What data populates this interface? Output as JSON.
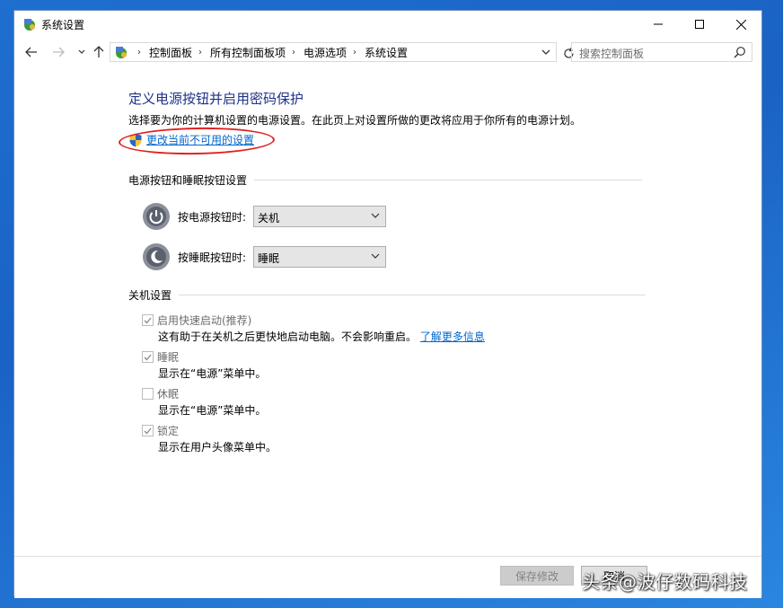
{
  "window": {
    "title": "系统设置",
    "controls": {
      "minimize": "—",
      "maximize": "☐",
      "close": "✕"
    }
  },
  "addressbar": {
    "breadcrumbs": [
      "控制面板",
      "所有控制面板项",
      "电源选项",
      "系统设置"
    ],
    "search_placeholder": "搜索控制面板"
  },
  "main": {
    "title": "定义电源按钮并启用密码保护",
    "description": "选择要为你的计算机设置的电源设置。在此页上对设置所做的更改将应用于你所有的电源计划。",
    "change_link": "更改当前不可用的设置",
    "power_section": {
      "heading": "电源按钮和睡眠按钮设置",
      "power_button": {
        "label": "按电源按钮时:",
        "value": "关机"
      },
      "sleep_button": {
        "label": "按睡眠按钮时:",
        "value": "睡眠"
      }
    },
    "shutdown_section": {
      "heading": "关机设置",
      "items": [
        {
          "label": "启用快速启动(推荐)",
          "checked": true,
          "desc": "这有助于在关机之后更快地启动电脑。不会影响重启。",
          "link": "了解更多信息"
        },
        {
          "label": "睡眠",
          "checked": true,
          "desc": "显示在“电源”菜单中。"
        },
        {
          "label": "休眠",
          "checked": false,
          "desc": "显示在“电源”菜单中。"
        },
        {
          "label": "锁定",
          "checked": true,
          "desc": "显示在用户头像菜单中。"
        }
      ]
    }
  },
  "footer": {
    "save_label": "保存修改",
    "cancel_label": "取消"
  },
  "watermark": "头条@波仔数码科技",
  "colors": {
    "title": "#1e3287",
    "link": "#0066cc",
    "highlight_ellipse": "#e02020"
  }
}
